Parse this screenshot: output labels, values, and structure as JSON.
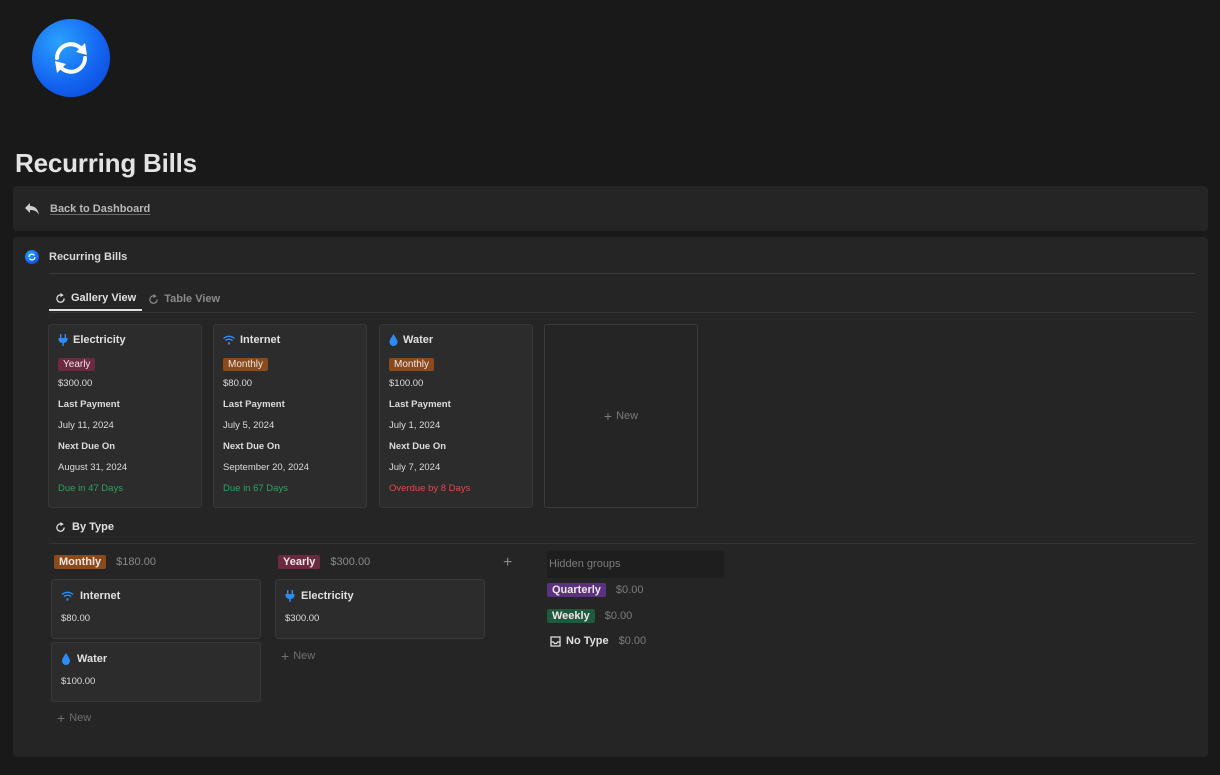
{
  "page": {
    "title": "Recurring Bills",
    "back_link": "Back to Dashboard"
  },
  "database": {
    "title": "Recurring Bills",
    "tabs": [
      {
        "label": "Gallery View",
        "active": true
      },
      {
        "label": "Table View",
        "active": false
      }
    ],
    "gallery": {
      "cards": [
        {
          "name": "Electricity",
          "icon": "plug-icon",
          "type": "Yearly",
          "amount": "$300.00",
          "last_payment_label": "Last Payment",
          "last_payment": "July 11, 2024",
          "next_due_label": "Next Due On",
          "next_due": "August 31, 2024",
          "status": "Due in 47 Days",
          "status_color": "#2fa35f"
        },
        {
          "name": "Internet",
          "icon": "wifi-icon",
          "type": "Monthly",
          "amount": "$80.00",
          "last_payment_label": "Last Payment",
          "last_payment": "July 5, 2024",
          "next_due_label": "Next Due On",
          "next_due": "September 20, 2024",
          "status": "Due in 67 Days",
          "status_color": "#2fa35f"
        },
        {
          "name": "Water",
          "icon": "water-drop-icon",
          "type": "Monthly",
          "amount": "$100.00",
          "last_payment_label": "Last Payment",
          "last_payment": "July 1, 2024",
          "next_due_label": "Next Due On",
          "next_due": "July 7, 2024",
          "status": "Overdue by 8 Days",
          "status_color": "#e5484d"
        }
      ],
      "new_label": "New"
    },
    "board": {
      "title": "By Type",
      "groups": [
        {
          "label": "Monthly",
          "sum": "$180.00",
          "cards": [
            {
              "name": "Internet",
              "icon": "wifi-icon",
              "amount": "$80.00"
            },
            {
              "name": "Water",
              "icon": "water-drop-icon",
              "amount": "$100.00"
            }
          ]
        },
        {
          "label": "Yearly",
          "sum": "$300.00",
          "cards": [
            {
              "name": "Electricity",
              "icon": "plug-icon",
              "amount": "$300.00"
            }
          ]
        }
      ],
      "new_label": "New",
      "hidden_groups_label": "Hidden groups",
      "hidden_groups": [
        {
          "label": "Quarterly",
          "sum": "$0.00"
        },
        {
          "label": "Weekly",
          "sum": "$0.00"
        },
        {
          "label": "No Type",
          "sum": "$0.00"
        }
      ]
    }
  },
  "colors": {
    "monthly_tag": "#8a4a1c",
    "yearly_tag": "#6b2942",
    "quarterly_tag": "#5a3380",
    "weekly_tag": "#1e5a3d",
    "icon_blue": "#2e8bf5",
    "due_green": "#2fa35f",
    "overdue_red": "#e5484d"
  }
}
